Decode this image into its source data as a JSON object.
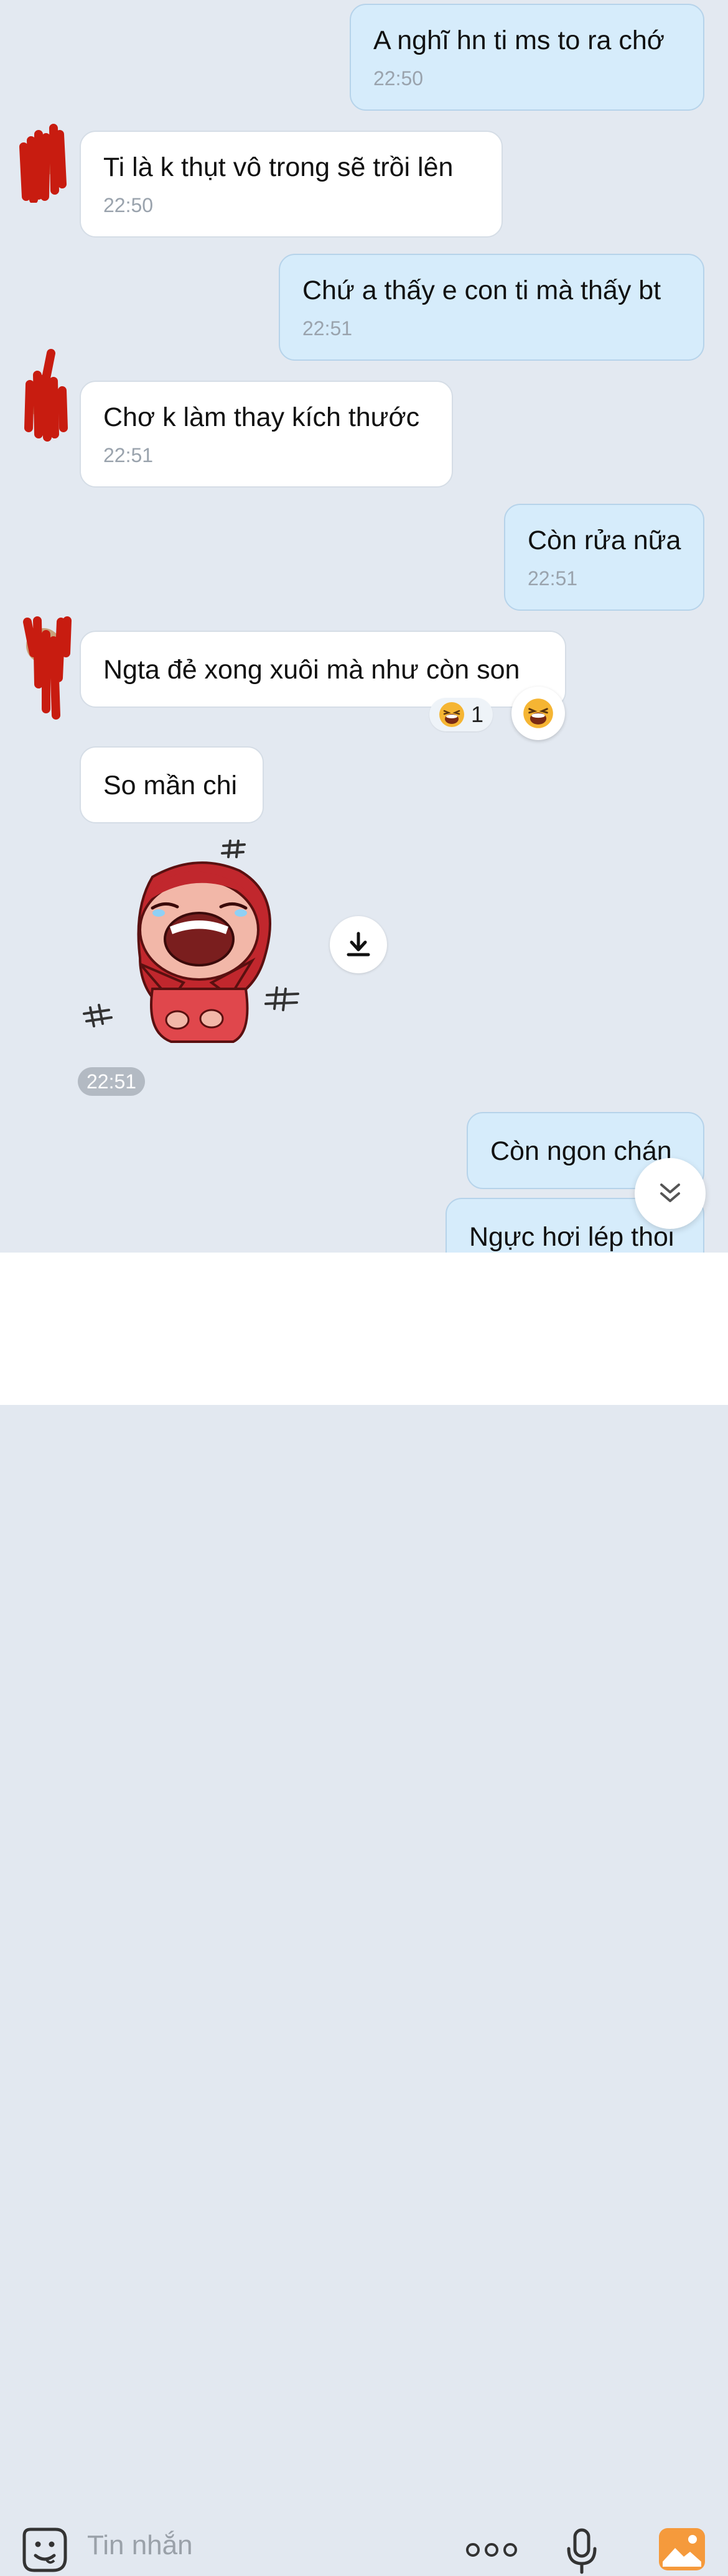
{
  "messages": [
    {
      "text": "A nghĩ hn ti ms to ra chớ",
      "time": "22:50"
    },
    {
      "text": "Ti là k thụt vô trong sẽ trồi lên",
      "time": "22:50"
    },
    {
      "text": "Chứ a thấy e con ti mà thấy bt",
      "time": "22:51"
    },
    {
      "text": "Chơ k làm thay kích thước",
      "time": "22:51"
    },
    {
      "text": "Còn rửa nữa",
      "time": "22:51"
    },
    {
      "text": "Ngta đẻ xong xuôi mà như còn son"
    },
    {
      "text": "So mần chi"
    },
    {
      "text": "Còn ngon chán"
    },
    {
      "text": "Ngực hơi lép thoi"
    }
  ],
  "reaction": {
    "count": "1",
    "emoji": "laughing-tears"
  },
  "sticker": {
    "time": "22:51"
  },
  "input": {
    "placeholder": "Tin nhắn"
  },
  "colors": {
    "outgoing": "#d6ecfb",
    "incoming": "#ffffff",
    "background": "#e3e9f1",
    "accent_gallery": "#f59a3c"
  }
}
